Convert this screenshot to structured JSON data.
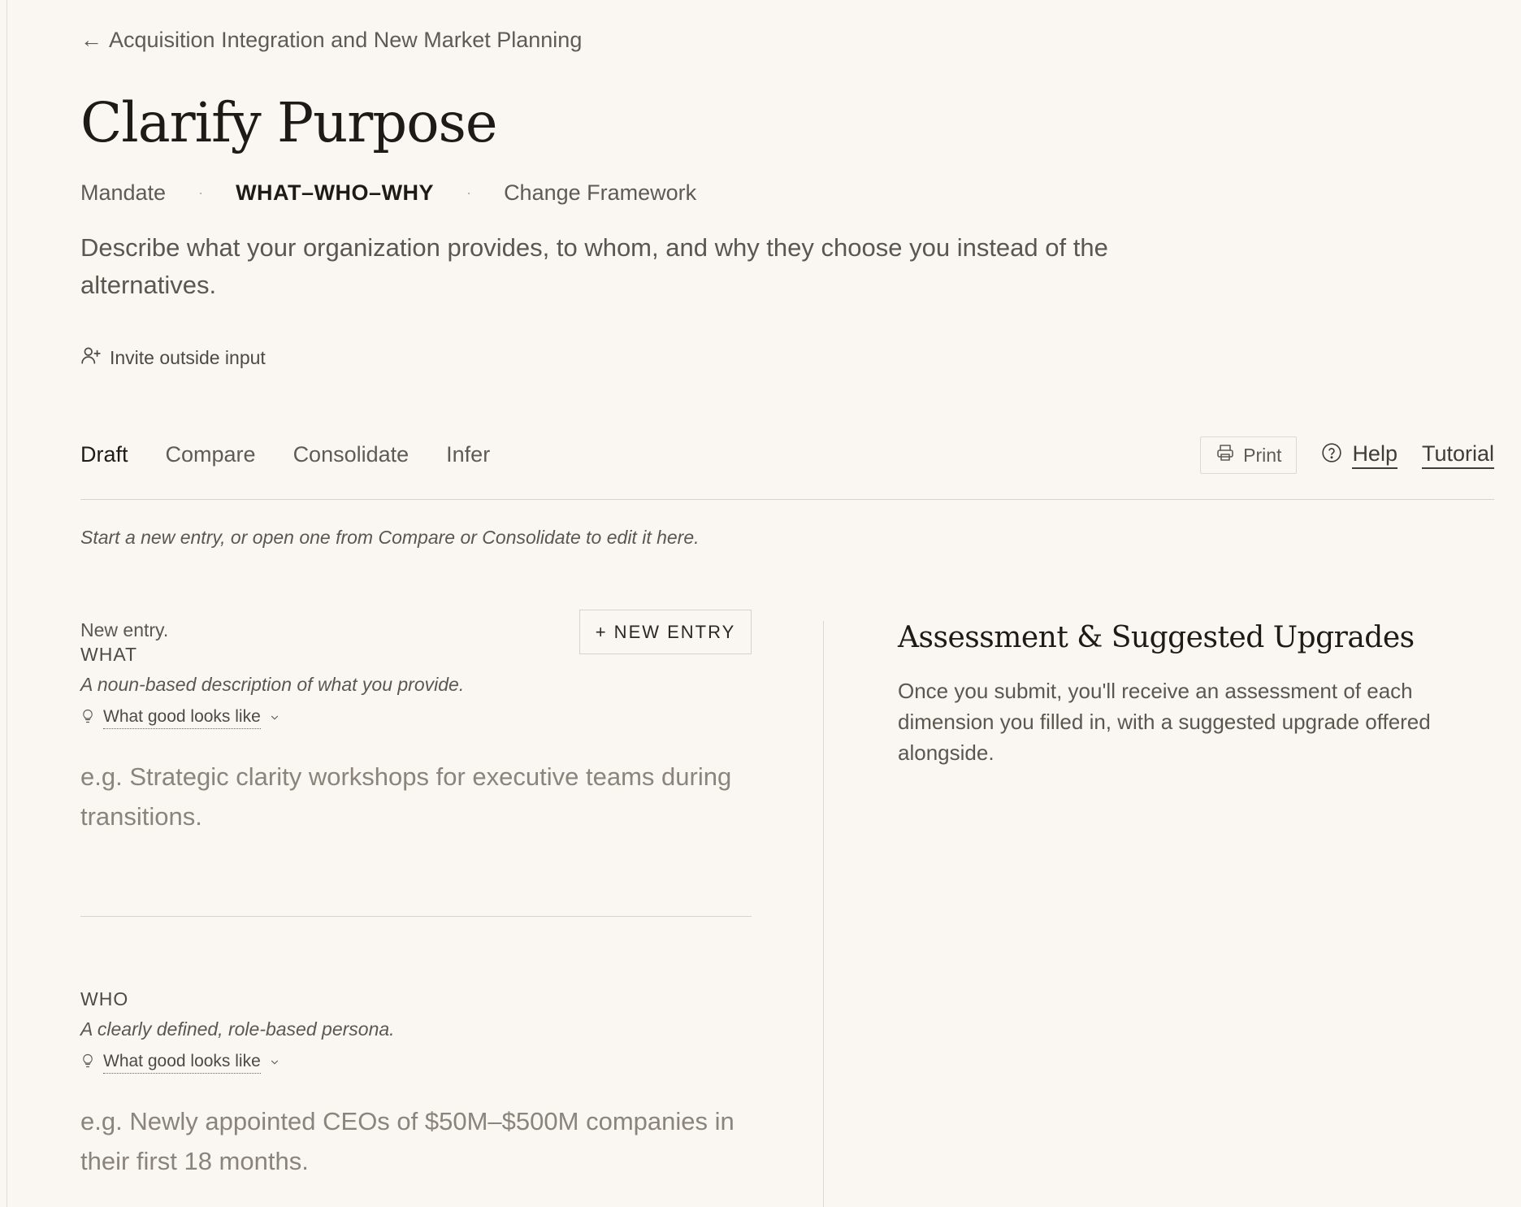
{
  "breadcrumb": {
    "arrow": "←",
    "label": "Acquisition Integration and New Market Planning"
  },
  "page": {
    "title": "Clarify Purpose",
    "description": "Describe what your organization provides, to whom, and why they choose you instead of the alternatives."
  },
  "frameworks": {
    "separator": "·",
    "items": [
      {
        "label": "Mandate",
        "active": false
      },
      {
        "label": "WHAT–WHO–WHY",
        "active": true
      },
      {
        "label": "Change Framework",
        "active": false
      }
    ]
  },
  "invite": {
    "icon": "user-plus-icon",
    "label": "Invite outside input"
  },
  "tabs": [
    {
      "label": "Draft",
      "active": true
    },
    {
      "label": "Compare",
      "active": false
    },
    {
      "label": "Consolidate",
      "active": false
    },
    {
      "label": "Infer",
      "active": false
    }
  ],
  "toolbar": {
    "print_icon": "printer-icon",
    "print_label": "Print",
    "help_icon": "question-circle-icon",
    "help_label": "Help",
    "tutorial_label": "Tutorial"
  },
  "hint": "Start a new entry, or open one from Compare or Consolidate to edit it here.",
  "entry": {
    "status": "New entry.",
    "new_entry_button": "+ NEW ENTRY"
  },
  "sections": [
    {
      "label": "WHAT",
      "subtitle": "A noun-based description of what you provide.",
      "guide_icon": "lightbulb-icon",
      "guide_label": "What good looks like",
      "value": "",
      "placeholder": "e.g. Strategic clarity workshops for executive teams during transitions."
    },
    {
      "label": "WHO",
      "subtitle": "A clearly defined, role-based persona.",
      "guide_icon": "lightbulb-icon",
      "guide_label": "What good looks like",
      "value": "",
      "placeholder": "e.g. Newly appointed CEOs of $50M–$500M companies in their first 18 months."
    }
  ],
  "assessment": {
    "title": "Assessment & Suggested Upgrades",
    "body": "Once you submit, you'll receive an assessment of each dimension you filled in, with a suggested upgrade offered alongside."
  },
  "colors": {
    "background": "#faf7f2",
    "text_primary": "#1d1a17",
    "text_secondary": "#5a5650",
    "placeholder": "#8a847c",
    "rule": "#d8d2c9"
  }
}
